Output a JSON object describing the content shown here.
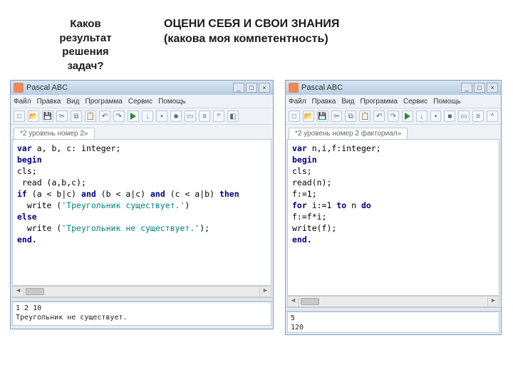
{
  "headings": {
    "left": "Каков результат решения задач?",
    "right_line1": "ОЦЕНИ СЕБЯ И СВОИ ЗНАНИЯ",
    "right_line2": "(какова моя компетентность)"
  },
  "app": {
    "title": "Pascal ABC"
  },
  "window_controls": {
    "minimize": "_",
    "maximize": "□",
    "close": "×"
  },
  "menu": {
    "file": "Файл",
    "edit": "Правка",
    "view": "Вид",
    "program": "Программа",
    "service": "Сервис",
    "help": "Помощь"
  },
  "toolbar_icons": {
    "new": "□",
    "open": "📂",
    "save": "💾",
    "cut": "✂",
    "copy": "⧉",
    "paste": "📋",
    "undo": "↶",
    "redo": "↷",
    "dot": "•",
    "step": "↓",
    "stop": "■",
    "box1": "▭",
    "box2": "≡",
    "caret": "^",
    "misc": "◧"
  },
  "left_ide": {
    "tab": "*2 уровень номер 2»",
    "code": {
      "l1": {
        "kw": "var",
        "rest": " a, b, c: integer;"
      },
      "l2": "begin",
      "l3": "cls;",
      "l4": " read (a,b,c);",
      "l5": {
        "kw1": "if",
        "p1": " (a < b|c) ",
        "kw2": "and",
        "p2": " (b < a|c) ",
        "kw3": "and",
        "p3": " (c < a|b) ",
        "kw4": "then"
      },
      "l6": {
        "p1": "  write (",
        "str": "'Треугольник существует.'",
        "p2": ")"
      },
      "l7": "else",
      "l8": {
        "p1": "  write (",
        "str": "'Треугольник не существует.'",
        "p2": ");"
      },
      "l9": "end."
    },
    "output": "1 2 10\nТреугольник не существует."
  },
  "right_ide": {
    "tab": "*2 уровень номер 2 факториал»",
    "code": {
      "l1": {
        "kw": "var",
        "rest": " n,i,f:integer;"
      },
      "l2": "begin",
      "l3": "cls;",
      "l4": "read(n);",
      "l5": "f:=1;",
      "l6": {
        "kw1": "for",
        "p1": " i:=1 ",
        "kw2": "to",
        "p2": " n ",
        "kw3": "do"
      },
      "l7": "f:=f*i;",
      "l8": "write(f);",
      "l9": "end."
    },
    "output": "5\n120"
  }
}
